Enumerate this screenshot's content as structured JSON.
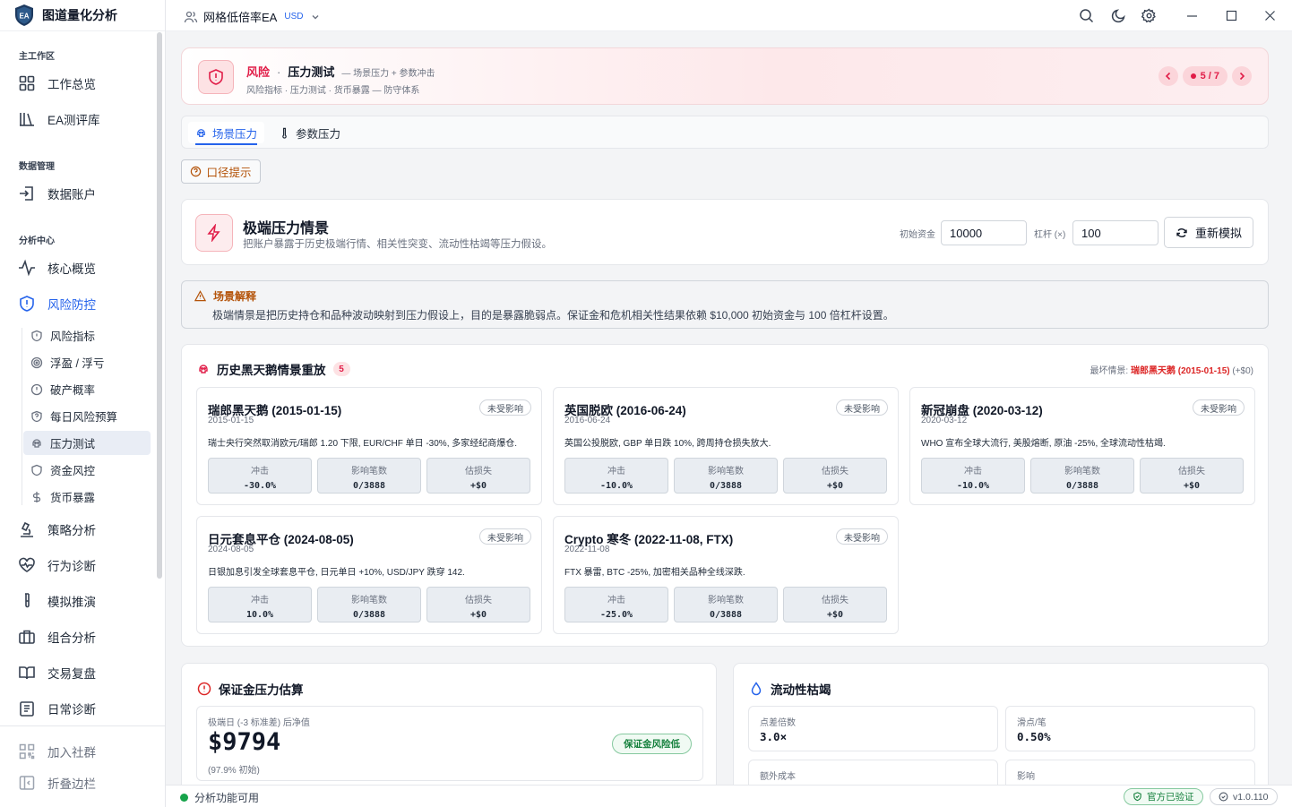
{
  "app": {
    "name": "图道量化分析",
    "logo_text": "EA"
  },
  "topbar": {
    "project": "网格低倍率EA",
    "currency": "USD"
  },
  "sidebar": {
    "sections": [
      {
        "label": "主工作区",
        "items": [
          "工作总览",
          "EA测评库"
        ]
      },
      {
        "label": "数据管理",
        "items": [
          "数据账户"
        ]
      },
      {
        "label": "分析中心",
        "items": [
          "核心概览",
          "风险防控",
          "策略分析",
          "行为诊断",
          "模拟推演",
          "组合分析",
          "交易复盘",
          "日常诊断"
        ]
      }
    ],
    "risk_sub": [
      "风险指标",
      "浮盈 / 浮亏",
      "破产概率",
      "每日风险预算",
      "压力测试",
      "资金风控",
      "货币暴露"
    ],
    "bottom": [
      "加入社群",
      "折叠边栏"
    ]
  },
  "hero": {
    "category": "风险",
    "page": "压力测试",
    "subtitle": "— 场景压力 + 参数冲击",
    "desc": "风险指标 · 压力测试 · 货币暴露 — 防守体系",
    "page_count": "5 / 7"
  },
  "tabs": [
    "场景压力",
    "参数压力"
  ],
  "hint_button": "口径提示",
  "scenario": {
    "title": "极端压力情景",
    "subtitle": "把账户暴露于历史极端行情、相关性突变、流动性枯竭等压力假设。",
    "capital_label": "初始资金",
    "capital": "10000",
    "leverage_label": "杠杆 (×)",
    "leverage": "100",
    "resim": "重新模拟"
  },
  "explain": {
    "title": "场景解释",
    "text": "极端情景是把历史持仓和品种波动映射到压力假设上，目的是暴露脆弱点。保证金和危机相关性结果依赖 $10,000 初始资金与 100 倍杠杆设置。"
  },
  "history": {
    "title": "历史黑天鹅情景重放",
    "count": "5",
    "worst_label": "最坏情景:",
    "worst_value": "瑞郎黑天鹅 (2015-01-15)",
    "worst_extra": "(+$0)",
    "metric_labels": [
      "冲击",
      "影响笔数",
      "估损失"
    ],
    "events": [
      {
        "title": "瑞郎黑天鹅 (2015-01-15)",
        "date": "2015-01-15",
        "tag": "未受影响",
        "desc": "瑞士央行突然取消欧元/瑞郎 1.20 下限, EUR/CHF 单日 -30%, 多家经纪商爆仓.",
        "shock": "-30.0%",
        "trades": "0/3888",
        "loss": "+$0"
      },
      {
        "title": "英国脱欧 (2016-06-24)",
        "date": "2016-06-24",
        "tag": "未受影响",
        "desc": "英国公投脱欧, GBP 单日跌 10%, 跨周持仓损失放大.",
        "shock": "-10.0%",
        "trades": "0/3888",
        "loss": "+$0"
      },
      {
        "title": "新冠崩盘 (2020-03-12)",
        "date": "2020-03-12",
        "tag": "未受影响",
        "desc": "WHO 宣布全球大流行, 美股熔断, 原油 -25%, 全球流动性枯竭.",
        "shock": "-10.0%",
        "trades": "0/3888",
        "loss": "+$0"
      },
      {
        "title": "日元套息平仓 (2024-08-05)",
        "date": "2024-08-05",
        "tag": "未受影响",
        "desc": "日银加息引发全球套息平仓, 日元单日 +10%, USD/JPY 跌穿 142.",
        "shock": "10.0%",
        "trades": "0/3888",
        "loss": "+$0"
      },
      {
        "title": "Crypto 寒冬 (2022-11-08, FTX)",
        "date": "2022-11-08",
        "tag": "未受影响",
        "desc": "FTX 暴雷, BTC -25%, 加密相关品种全线深跌.",
        "shock": "-25.0%",
        "trades": "0/3888",
        "loss": "+$0"
      }
    ]
  },
  "margin": {
    "title": "保证金压力估算",
    "label": "极端日 (-3 标准差) 后净值",
    "value": "$9794",
    "pct": "(97.9% 初始)",
    "badge": "保证金风险低"
  },
  "liquidity": {
    "title": "流动性枯竭",
    "cells": [
      {
        "label": "点差倍数",
        "value": "3.0×"
      },
      {
        "label": "滑点/笔",
        "value": "0.50%"
      },
      {
        "label": "额外成本",
        "value": ""
      },
      {
        "label": "影响",
        "value": ""
      }
    ]
  },
  "status": {
    "text": "分析功能可用",
    "verified": "官方已验证",
    "version": "v1.0.110"
  },
  "colors": {
    "accent": "#2563eb",
    "danger": "#e11d48",
    "success": "#16a34a",
    "warn": "#b45309"
  }
}
